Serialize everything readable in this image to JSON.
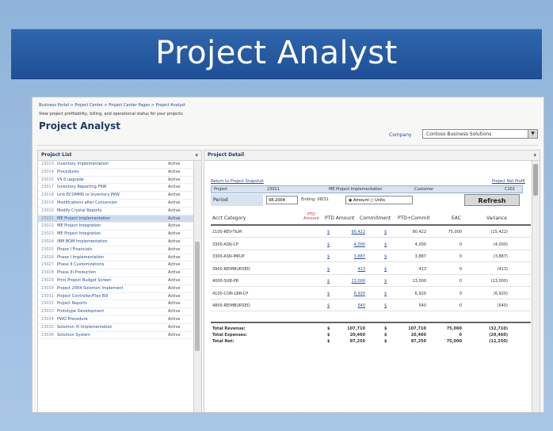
{
  "slide": {
    "title": "Project Analyst"
  },
  "portal": {
    "breadcrumb": "Business Portal > Project Center > Project Center Pages > Project Analyst",
    "subtitle": "View project profitability, billing, and operational status for your projects",
    "page_title": "Project Analyst",
    "company_label": "Company",
    "company_value": "Contoso Business Solutions"
  },
  "project_list": {
    "header": "Project List",
    "menu_glyph": "▾",
    "rows": [
      {
        "id": "23013",
        "name": "Inventory Implementation",
        "status": "Active"
      },
      {
        "id": "23014",
        "name": "Procedures",
        "status": "Active"
      },
      {
        "id": "23015",
        "name": "V5.0 upgrade",
        "status": "Active"
      },
      {
        "id": "23017",
        "name": "Inventory Reporting FRW",
        "status": "Active"
      },
      {
        "id": "23018",
        "name": "Link ECOMMS to Inventory PKW",
        "status": "Active"
      },
      {
        "id": "23019",
        "name": "Modifications after Conversion",
        "status": "Active"
      },
      {
        "id": "23020",
        "name": "Modify Crystal Reports",
        "status": "Active"
      },
      {
        "id": "23021",
        "name": "ME Project Implementation",
        "status": "Active",
        "selected": true
      },
      {
        "id": "23022",
        "name": "ME Project Integration",
        "status": "Active"
      },
      {
        "id": "23023",
        "name": "ME Project Integration",
        "status": "Active"
      },
      {
        "id": "23024",
        "name": "IBM BOM Implementation",
        "status": "Active"
      },
      {
        "id": "23025",
        "name": "Phase I Financials",
        "status": "Active"
      },
      {
        "id": "23026",
        "name": "Phase I Implementation",
        "status": "Active"
      },
      {
        "id": "23027",
        "name": "Phase II Customizations",
        "status": "Active"
      },
      {
        "id": "23028",
        "name": "Phase III Production",
        "status": "Active"
      },
      {
        "id": "23029",
        "name": "Print Project Budget Screen",
        "status": "Active"
      },
      {
        "id": "23030",
        "name": "Project 2004 Solomon Implement",
        "status": "Active"
      },
      {
        "id": "23031",
        "name": "Project Controller/Flex Bill",
        "status": "Active"
      },
      {
        "id": "23032",
        "name": "Project Reports",
        "status": "Active"
      },
      {
        "id": "23033",
        "name": "Prototype Development",
        "status": "Active"
      },
      {
        "id": "23034",
        "name": "PWO Procedure",
        "status": "Active"
      },
      {
        "id": "23035",
        "name": "Solomon IV Implementation",
        "status": "Active"
      },
      {
        "id": "23036",
        "name": "Solomon System",
        "status": "Active"
      }
    ]
  },
  "project_detail": {
    "header": "Project Detail",
    "menu_glyph": "▾",
    "return_link": "Return to Project Snapshot",
    "net_profit_link": "Project Net Profit",
    "info": {
      "project_label": "Project",
      "project_id": "23021",
      "project_name": "ME Project Implementation",
      "customer_label": "Customer",
      "customer_value": "C201"
    },
    "period": {
      "label": "Period",
      "value": "08-2004",
      "ending": "Ending: 08/31",
      "radio_amount": "◉ Amount",
      "radio_units": "○ Units",
      "refresh": "Refresh"
    },
    "columns": {
      "acct": "Acct Category",
      "ptd_flag": "PTD Amount",
      "ptd_amount": "PTD Amount",
      "commitment": "Commitment",
      "ptd_commit": "PTD+Commit",
      "eac": "EAC",
      "variance": "Variance"
    },
    "rows": [
      {
        "acct": "2100-REV-T&M",
        "ptd": "$",
        "amount": "90,422",
        "comm": "$",
        "total": "90,422",
        "eac": "75,000",
        "var": "(15,422)"
      },
      {
        "acct": "3300-ASN-CP",
        "ptd": "$",
        "amount": "4,000",
        "comm": "$",
        "total": "4,000",
        "eac": "0",
        "var": "(4,000)"
      },
      {
        "acct": "3300-ASN-MKUP",
        "ptd": "$",
        "amount": "3,887",
        "comm": "$",
        "total": "3,887",
        "eac": "0",
        "var": "(3,887)"
      },
      {
        "acct": "3900-REIMBURSED",
        "ptd": "$",
        "amount": "413",
        "comm": "$",
        "total": "413",
        "eac": "0",
        "var": "(413)"
      },
      {
        "acct": "4000-SUB-PR",
        "ptd": "$",
        "amount": "13,000",
        "comm": "$",
        "total": "13,000",
        "eac": "0",
        "var": "(13,000)"
      },
      {
        "acct": "4100-CON-LBR-CP",
        "ptd": "$",
        "amount": "6,920",
        "comm": "$",
        "total": "6,920",
        "eac": "0",
        "var": "(6,920)"
      },
      {
        "acct": "4800-REIMBURSED",
        "ptd": "$",
        "amount": "540",
        "comm": "$",
        "total": "540",
        "eac": "0",
        "var": "(540)"
      }
    ],
    "summary": [
      {
        "label": "Total Revenue:",
        "s1": "$",
        "s2": "107,710",
        "s3": "$",
        "s4": "107,710",
        "s5": "75,000",
        "s6": "(32,710)"
      },
      {
        "label": "Total Expenses:",
        "s1": "$",
        "s2": "20,460",
        "s3": "$",
        "s4": "20,460",
        "s5": "0",
        "s6": "(20,460)"
      },
      {
        "label": "Total Net:",
        "s1": "$",
        "s2": "87,250",
        "s3": "$",
        "s4": "87,250",
        "s5": "75,000",
        "s6": "(12,250)"
      }
    ]
  }
}
